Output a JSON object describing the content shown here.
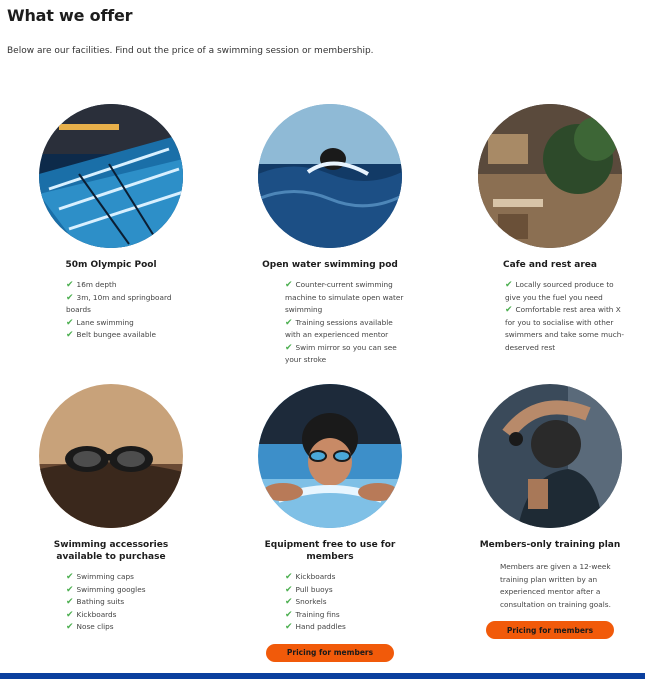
{
  "page": {
    "title": "What we offer",
    "intro": "Below are our facilities. Find out the price of a swimming session or membership."
  },
  "cards": [
    {
      "title": "50m Olympic Pool",
      "features": [
        "16m depth",
        "3m, 10m and springboard boards",
        "Lane swimming",
        "Belt bungee available"
      ]
    },
    {
      "title": "Open water swimming pod",
      "features": [
        "Counter-current swimming machine to simulate open water swimming",
        "Training sessions available with an experienced mentor",
        "Swim mirror so you can see your stroke"
      ]
    },
    {
      "title": "Cafe and rest area",
      "features": [
        "Locally sourced produce to give you the fuel you need",
        "Comfortable rest area with X for you to socialise with other swimmers and take some much-deserved rest"
      ]
    },
    {
      "title": "Swimming accessories available to purchase",
      "features": [
        "Swimming caps",
        "Swimming googles",
        "Bathing suits",
        "Kickboards",
        "Nose clips"
      ]
    },
    {
      "title": "Equipment free to use for members",
      "features": [
        "Kickboards",
        "Pull buoys",
        "Snorkels",
        "Training fins",
        "Hand paddles"
      ],
      "button": "Pricing for members"
    },
    {
      "title": "Members-only training plan",
      "description": "Members are given a 12-week training plan written by an experienced mentor after a consultation on training goals.",
      "button": "Pricing for members"
    }
  ],
  "icons": {
    "feature": "check-icon"
  },
  "colors": {
    "accent": "#f15a0a",
    "check": "#4caf50",
    "footer": "#0b3f9e"
  }
}
